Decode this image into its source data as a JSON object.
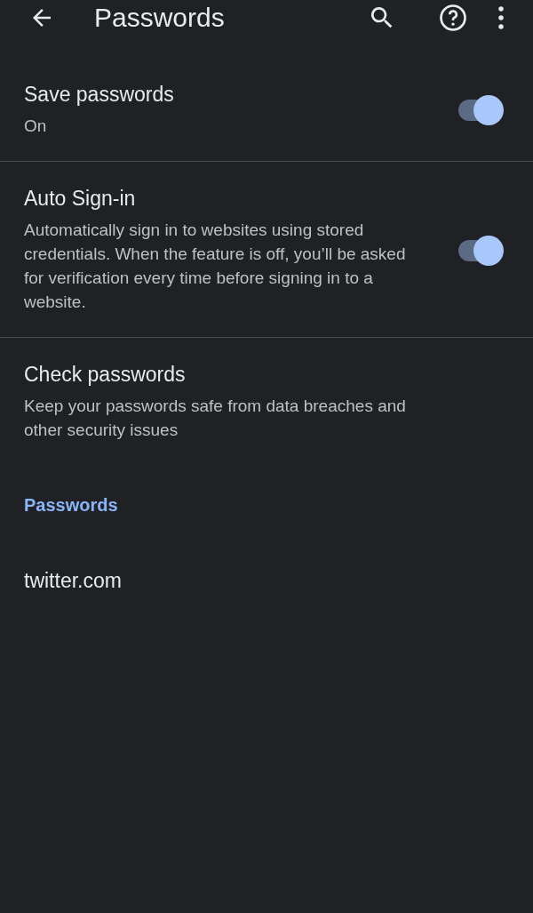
{
  "toolbar": {
    "title": "Passwords"
  },
  "settings": [
    {
      "kind": "toggle",
      "title": "Save passwords",
      "summary": "On",
      "on": true
    },
    {
      "kind": "toggle",
      "title": "Auto Sign-in",
      "summary": "Automatically sign in to websites using stored credentials. When the feature is off, you’ll be asked for verification every time before signing in to a website.",
      "on": true
    },
    {
      "kind": "link",
      "title": "Check passwords",
      "summary": "Keep your passwords safe from data breaches and other security issues"
    }
  ],
  "section": {
    "header": "Passwords",
    "items": [
      "twitter.com"
    ]
  }
}
